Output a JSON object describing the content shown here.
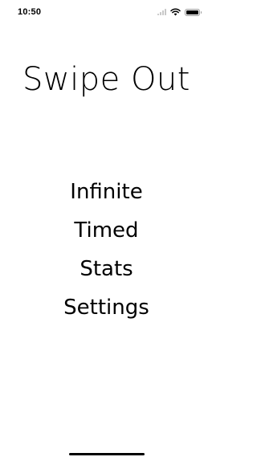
{
  "status_bar": {
    "time": "10:50",
    "icons": [
      "cellular-signal-icon",
      "wifi-icon",
      "battery-icon"
    ],
    "battery_level": 1.0
  },
  "title": "Swipe Out",
  "menu": {
    "items": [
      {
        "label": "Infinite"
      },
      {
        "label": "Timed"
      },
      {
        "label": "Stats"
      },
      {
        "label": "Settings"
      }
    ]
  },
  "colors": {
    "background": "#ffffff",
    "text": "#000000"
  }
}
